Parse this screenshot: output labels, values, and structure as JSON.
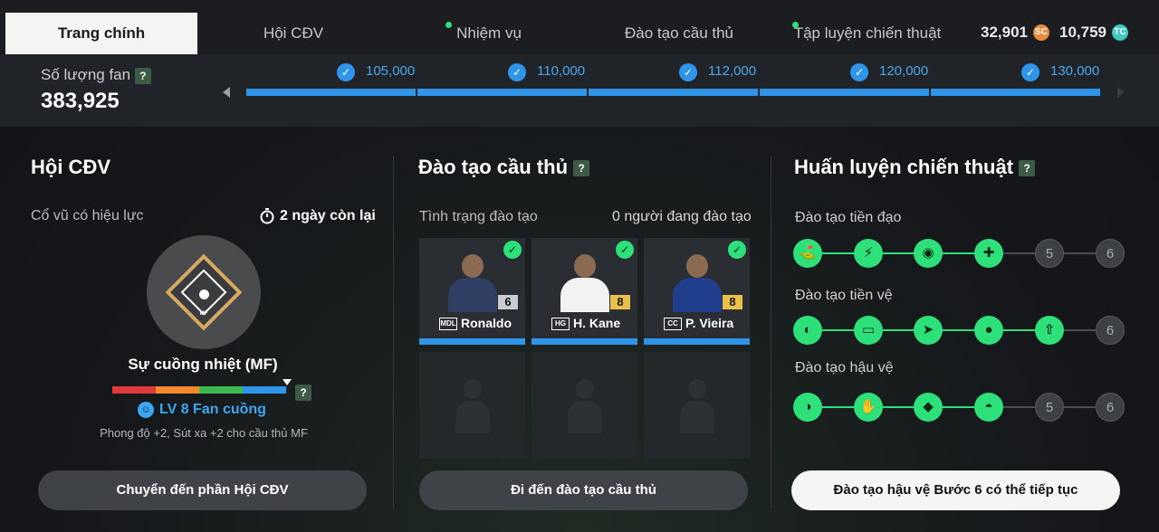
{
  "tabs": [
    {
      "label": "Trang chính",
      "active": true,
      "dot": false
    },
    {
      "label": "Hội CĐV",
      "active": false,
      "dot": false
    },
    {
      "label": "Nhiệm vụ",
      "active": false,
      "dot": true
    },
    {
      "label": "Đào tạo cầu thủ",
      "active": false,
      "dot": false
    },
    {
      "label": "Tập luyện chiến thuật",
      "active": false,
      "dot": true
    }
  ],
  "currency": {
    "sc": {
      "amount": "32,901",
      "icon_text": "SC",
      "color": "#e98a3c"
    },
    "tc": {
      "amount": "10,759",
      "icon_text": "TC",
      "color": "#3fc9c0"
    }
  },
  "fans": {
    "label": "Số lượng fan",
    "help": "?",
    "count": "383,925",
    "milestones": [
      "105,000",
      "110,000",
      "112,000",
      "120,000",
      "130,000"
    ]
  },
  "club": {
    "title": "Hội CĐV",
    "effect_label": "Cổ vũ có hiệu lực",
    "time_left": "2 ngày còn lại",
    "badge_pos": "MF",
    "badge_name": "Sự cuồng nhiệt (MF)",
    "level_text": "LV 8 Fan cuồng",
    "help": "?",
    "bonus": "Phong độ +2, Sút xa +2 cho cầu thủ MF",
    "button": "Chuyển đến phần Hội CĐV",
    "level_colors": [
      "#e0393b",
      "#f08a2c",
      "#3fb94f",
      "#2f95e8"
    ]
  },
  "training": {
    "title": "Đào tạo cầu thủ",
    "help": "?",
    "status_label": "Tình trạng đào tạo",
    "status_value": "0 người đang đào tạo",
    "players": [
      {
        "name": "Ronaldo",
        "pos": "MDL",
        "level": "6",
        "level_color": "#c9ccd0",
        "shirt": "#2e3f63"
      },
      {
        "name": "H. Kane",
        "pos": "HG",
        "level": "8",
        "level_color": "#e8c04a",
        "shirt": "#f2f2f2"
      },
      {
        "name": "P. Vieira",
        "pos": "CC",
        "level": "8",
        "level_color": "#e8c04a",
        "shirt": "#1f3f8c"
      }
    ],
    "button": "Đi đến đào tạo cầu thủ"
  },
  "tactics": {
    "title": "Huấn luyện chiến thuật",
    "help": "?",
    "rows": [
      {
        "label": "Đào tạo tiền đạo",
        "steps": [
          "⛳",
          "⚡",
          "◉",
          "✚",
          "5",
          "6"
        ],
        "done": 4
      },
      {
        "label": "Đào tạo tiền vệ",
        "steps": [
          "◐",
          "▭",
          "➤",
          "●",
          "⇧",
          "6"
        ],
        "done": 5
      },
      {
        "label": "Đào tạo hậu vệ",
        "steps": [
          "◑",
          "✋",
          "◆",
          "◓",
          "5",
          "6"
        ],
        "done": 4
      }
    ],
    "button": "Đào tạo hậu vệ Bước 6 có thể tiếp tục"
  },
  "colors": {
    "accent_blue": "#2f95e8",
    "accent_green": "#2de07a"
  }
}
